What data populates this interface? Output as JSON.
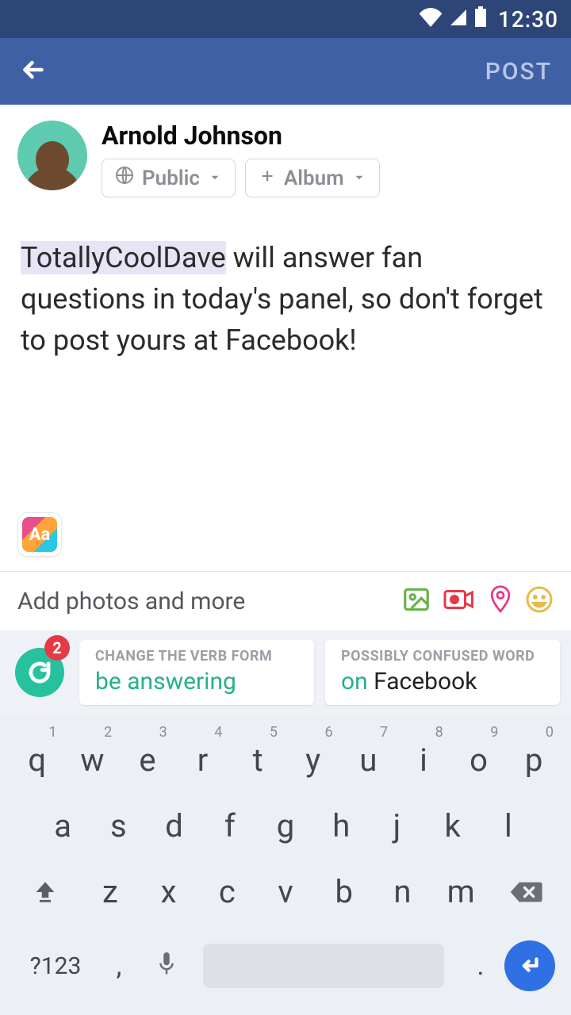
{
  "status": {
    "time": "12:30"
  },
  "header": {
    "post_label": "POST"
  },
  "author": {
    "name": "Arnold Johnson",
    "audience_label": "Public",
    "album_label": "Album"
  },
  "post": {
    "highlight": "TotallyCoolDave",
    "rest": " will answer fan questions in today's panel, so don't forget to post yours at Facebook!"
  },
  "style_button_text": "Aa",
  "add_bar": {
    "label": "Add photos and more"
  },
  "grammarly": {
    "badge_count": "2",
    "suggestions": [
      {
        "caption": "CHANGE THE VERB FORM",
        "replacement": "be answering",
        "context": ""
      },
      {
        "caption": "POSSIBLY CONFUSED WORD",
        "replacement": "on ",
        "context": "Facebook"
      }
    ]
  },
  "keyboard": {
    "row1": [
      {
        "k": "q",
        "n": "1"
      },
      {
        "k": "w",
        "n": "2"
      },
      {
        "k": "e",
        "n": "3"
      },
      {
        "k": "r",
        "n": "4"
      },
      {
        "k": "t",
        "n": "5"
      },
      {
        "k": "y",
        "n": "6"
      },
      {
        "k": "u",
        "n": "7"
      },
      {
        "k": "i",
        "n": "8"
      },
      {
        "k": "o",
        "n": "9"
      },
      {
        "k": "p",
        "n": "0"
      }
    ],
    "row2": [
      "a",
      "s",
      "d",
      "f",
      "g",
      "h",
      "j",
      "k",
      "l"
    ],
    "row3": [
      "z",
      "x",
      "c",
      "v",
      "b",
      "n",
      "m"
    ],
    "sym_label": "?123",
    "comma": ",",
    "period": "."
  }
}
